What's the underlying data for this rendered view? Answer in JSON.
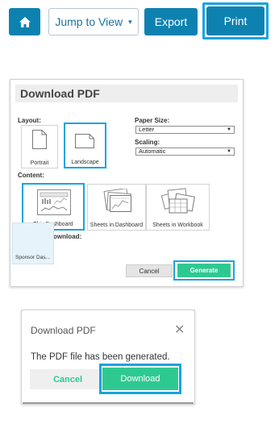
{
  "toolbar": {
    "home_icon": "home-icon",
    "jump_label": "Jump to View",
    "jump_caret": "▾",
    "export_label": "Export",
    "print_label": "Print"
  },
  "download_dialog": {
    "title": "Download PDF",
    "layout_label": "Layout:",
    "portrait_label": "Portrait",
    "landscape_label": "Landscape",
    "paper_size_label": "Paper Size:",
    "paper_size_value": "Letter",
    "scaling_label": "Scaling:",
    "scaling_value": "Automatic",
    "content_label": "Content:",
    "content_options": [
      "This Dashboard",
      "Sheets in Dashboard",
      "Sheets in Workbook"
    ],
    "sheets_label": "Sheets to Download:",
    "sheet_item": "Sponsor Das...",
    "cancel_label": "Cancel",
    "generate_label": "Generate"
  },
  "generated_dialog": {
    "title": "Download PDF",
    "close_glyph": "✕",
    "message": "The PDF file has been generated.",
    "cancel_label": "Cancel",
    "download_label": "Download"
  },
  "colors": {
    "primary_blue": "#0d82b0",
    "highlight_blue": "#19a3e0",
    "green": "#2ec991"
  }
}
